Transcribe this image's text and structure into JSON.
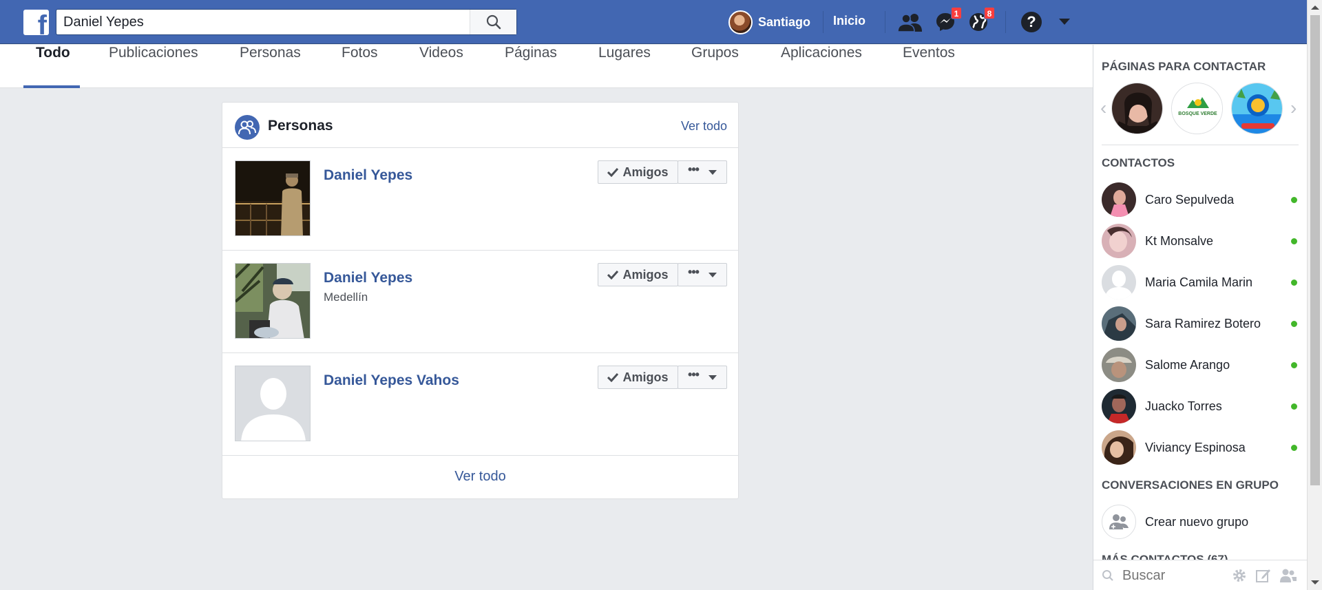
{
  "header": {
    "search_value": "Daniel Yepes",
    "user_name": "Santiago",
    "home_label": "Inicio",
    "messages_badge": "1",
    "notifications_badge": "8"
  },
  "tabs": [
    {
      "label": "Todo",
      "active": true
    },
    {
      "label": "Publicaciones"
    },
    {
      "label": "Personas"
    },
    {
      "label": "Fotos"
    },
    {
      "label": "Videos"
    },
    {
      "label": "Páginas"
    },
    {
      "label": "Lugares"
    },
    {
      "label": "Grupos"
    },
    {
      "label": "Aplicaciones"
    },
    {
      "label": "Eventos"
    }
  ],
  "people_card": {
    "title": "Personas",
    "see_all_top": "Ver todo",
    "see_all_bottom": "Ver todo",
    "results": [
      {
        "name": "Daniel Yepes",
        "subtitle": "",
        "friend_label": "Amigos"
      },
      {
        "name": "Daniel Yepes",
        "subtitle": "Medellín",
        "friend_label": "Amigos"
      },
      {
        "name": "Daniel Yepes Vahos",
        "subtitle": "",
        "friend_label": "Amigos"
      }
    ]
  },
  "sidebar": {
    "pages_heading": "PÁGINAS PARA CONTACTAR",
    "page_logo_text": "BOSQUE VERDE",
    "contacts_heading": "CONTACTOS",
    "contacts": [
      {
        "name": "Caro Sepulveda",
        "online": true
      },
      {
        "name": "Kt Monsalve",
        "online": true
      },
      {
        "name": "Maria Camila Marin",
        "online": true
      },
      {
        "name": "Sara Ramirez Botero",
        "online": true
      },
      {
        "name": "Salome Arango",
        "online": true
      },
      {
        "name": "Juacko Torres",
        "online": true
      },
      {
        "name": "Viviancy Espinosa",
        "online": true
      }
    ],
    "groups_heading": "CONVERSACIONES EN GRUPO",
    "create_group_label": "Crear nuevo grupo",
    "more_contacts_heading": "MÁS CONTACTOS (67)",
    "search_placeholder": "Buscar"
  },
  "colors": {
    "brand": "#4267b2",
    "link": "#365899",
    "online": "#42b72a",
    "badge": "#fa3e3e"
  }
}
